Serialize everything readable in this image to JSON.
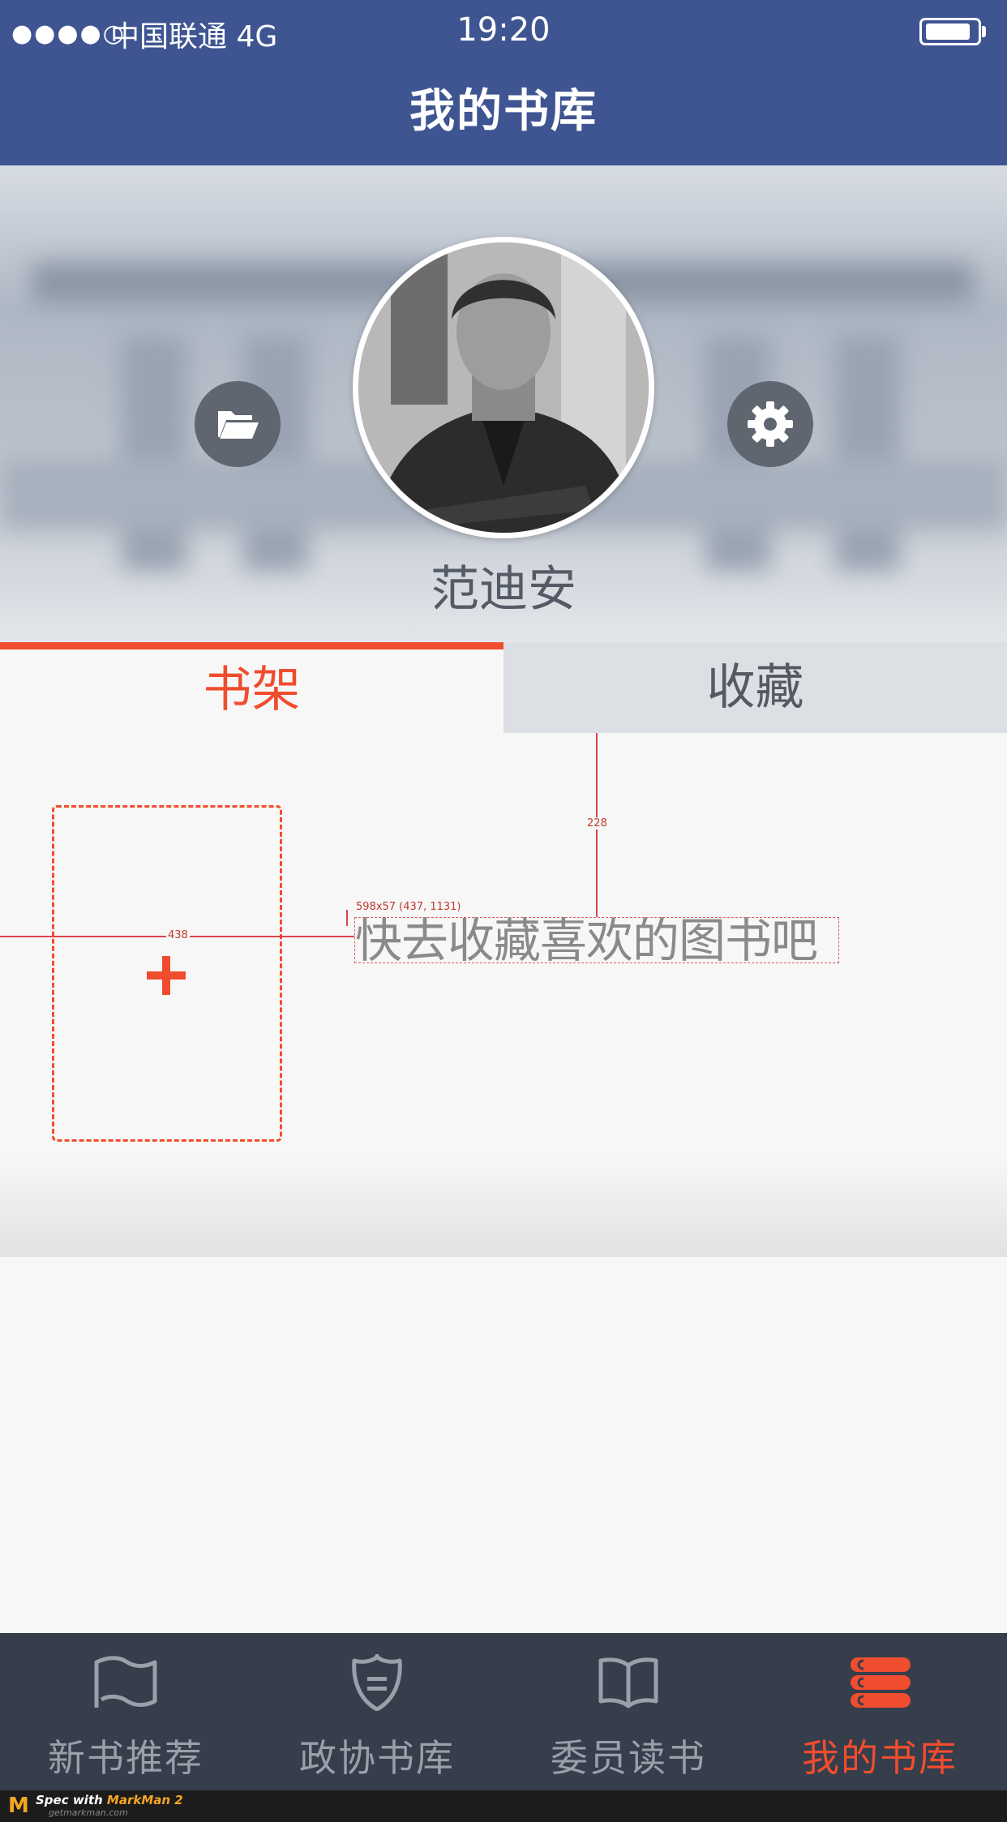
{
  "status_bar": {
    "signal": "●●●●○",
    "carrier": "中国联通  4G",
    "time": "19:20"
  },
  "nav": {
    "title": "我的书库"
  },
  "profile": {
    "name": "范迪安",
    "folder_icon": "folder-open-icon",
    "settings_icon": "gear-icon"
  },
  "tabs": [
    {
      "label": "书架",
      "active": true
    },
    {
      "label": "收藏",
      "active": false
    }
  ],
  "shelf": {
    "add_icon": "plus-icon",
    "empty_hint": "快去收藏喜欢的图书吧"
  },
  "spec_overlay": {
    "box_label": "598x57 (437, 1131)",
    "vertical_distance": "228",
    "horizontal_distance": "438"
  },
  "tabbar": {
    "items": [
      {
        "label": "新书推荐",
        "icon": "flag-icon",
        "active": false
      },
      {
        "label": "政协书库",
        "icon": "shield-icon",
        "active": false
      },
      {
        "label": "委员读书",
        "icon": "open-book-icon",
        "active": false
      },
      {
        "label": "我的书库",
        "icon": "book-stack-icon",
        "active": true
      }
    ]
  },
  "footer": {
    "prefix": "Spec with ",
    "brand": "MarkMan 2",
    "url": "getmarkman.com"
  },
  "colors": {
    "nav_bg": "#3f5592",
    "accent": "#f04d2e",
    "tabbar_bg": "#363d4b",
    "inactive_tab_bg": "#dcdfe3"
  }
}
